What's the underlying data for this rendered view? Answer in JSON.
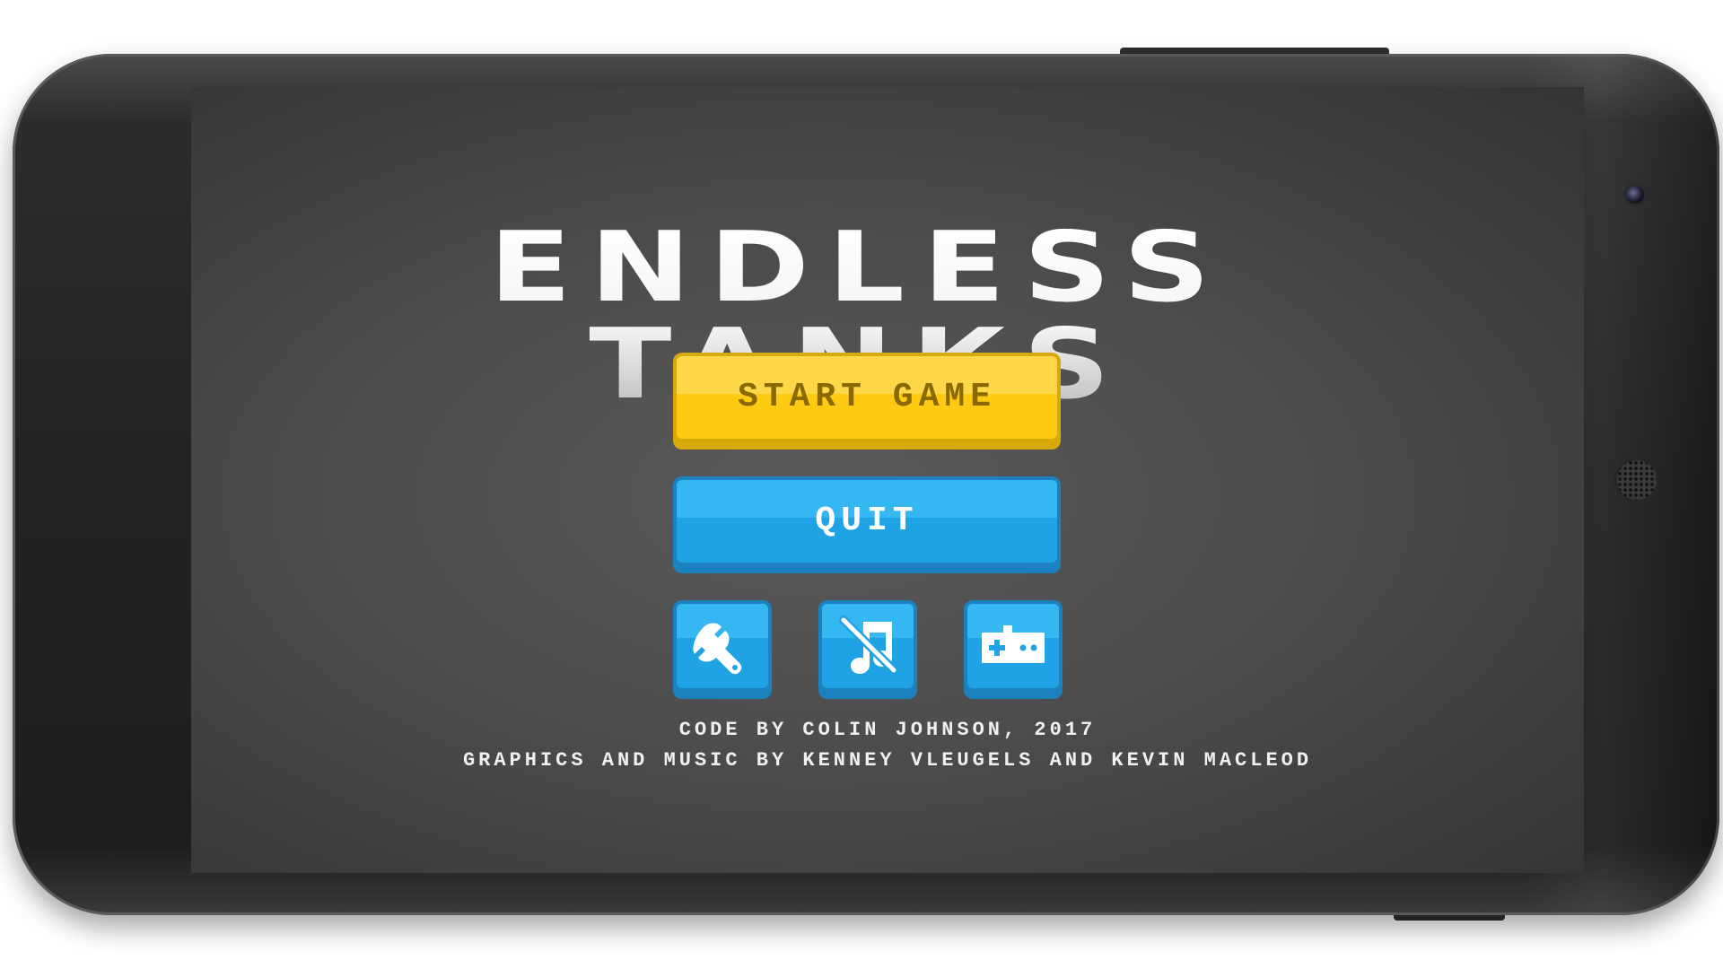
{
  "game": {
    "title": "ENDLESS TANKS"
  },
  "menu": {
    "start_label": "START GAME",
    "quit_label": "QUIT"
  },
  "icon_buttons": {
    "settings_icon": "wrench-icon",
    "music_icon": "music-muted-icon",
    "controls_icon": "gamepad-icon"
  },
  "credits": {
    "line1": "CODE BY COLIN JOHNSON, 2017",
    "line2": "GRAPHICS AND MUSIC BY KENNEY VLEUGELS AND KEVIN MACLEOD"
  },
  "colors": {
    "start_button": "#fecb12",
    "quit_button": "#1fa3e4",
    "background": "#4c4c4c"
  }
}
